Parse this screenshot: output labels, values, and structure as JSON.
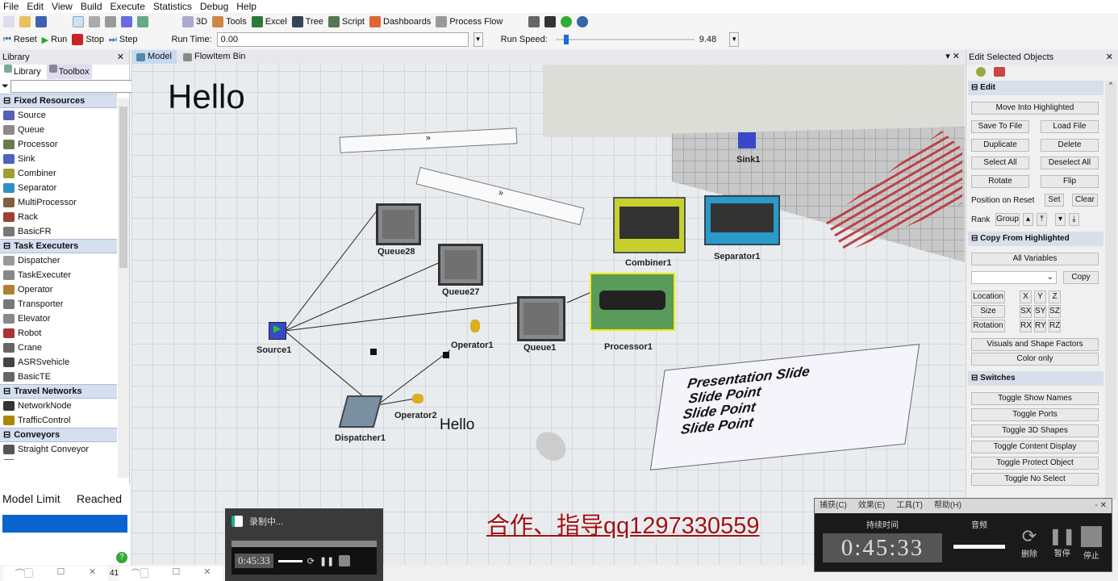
{
  "menu": [
    "File",
    "Edit",
    "View",
    "Build",
    "Execute",
    "Statistics",
    "Debug",
    "Help"
  ],
  "toolbar": {
    "3d": "3D",
    "tools": "Tools",
    "excel": "Excel",
    "tree": "Tree",
    "script": "Script",
    "dashboards": "Dashboards",
    "process_flow": "Process Flow"
  },
  "run": {
    "reset": "Reset",
    "run": "Run",
    "stop": "Stop",
    "step": "Step",
    "run_time_label": "Run Time:",
    "run_time": "0.00",
    "run_speed_label": "Run Speed:",
    "run_speed": "9.48"
  },
  "library": {
    "title": "Library",
    "tab_library": "Library",
    "tab_toolbox": "Toolbox",
    "search_placeholder": "",
    "sections": [
      {
        "title": "Fixed Resources",
        "items": [
          "Source",
          "Queue",
          "Processor",
          "Sink",
          "Combiner",
          "Separator",
          "MultiProcessor",
          "Rack",
          "BasicFR"
        ]
      },
      {
        "title": "Task Executers",
        "items": [
          "Dispatcher",
          "TaskExecuter",
          "Operator",
          "Transporter",
          "Elevator",
          "Robot",
          "Crane",
          "ASRSvehicle",
          "BasicTE"
        ]
      },
      {
        "title": "Travel Networks",
        "items": [
          "NetworkNode",
          "TrafficControl"
        ]
      },
      {
        "title": "Conveyors",
        "items": [
          "Straight Conveyor",
          "Curved Conveyor"
        ]
      }
    ]
  },
  "model_limit": {
    "left": "Model Limit",
    "right": "Reached"
  },
  "tabs": {
    "model": "Model",
    "flowitem_bin": "FlowItem Bin"
  },
  "canvas": {
    "hello_big": "Hello",
    "hello_small": "Hello",
    "objects": {
      "queue28": "Queue28",
      "queue27": "Queue27",
      "queue1": "Queue1",
      "source1": "Source1",
      "operator1": "Operator1",
      "operator2": "Operator2",
      "dispatcher1": "Dispatcher1",
      "processor1": "Processor1",
      "combiner1": "Combiner1",
      "separator1": "Separator1",
      "sink1": "Sink1"
    },
    "slide": {
      "title": "Presentation Slide",
      "points": [
        "Slide Point",
        "Slide Point",
        "Slide Point"
      ]
    },
    "watermark": "合作、指导qq1297330559"
  },
  "edit_panel": {
    "title": "Edit Selected Objects",
    "edit": "Edit",
    "move_into": "Move Into Highlighted",
    "save_to_file": "Save To File",
    "load_file": "Load File",
    "duplicate": "Duplicate",
    "delete": "Delete",
    "select_all": "Select All",
    "deselect_all": "Deselect All",
    "rotate": "Rotate",
    "flip": "Flip",
    "position_on_reset": "Position on Reset",
    "set": "Set",
    "clear": "Clear",
    "rank": "Rank",
    "group": "Group",
    "copy_from": "Copy From Highlighted",
    "all_variables": "All Variables",
    "copy": "Copy",
    "location": "Location",
    "size": "Size",
    "rotation": "Rotation",
    "x": "X",
    "y": "Y",
    "z": "Z",
    "sx": "SX",
    "sy": "SY",
    "sz": "SZ",
    "rx": "RX",
    "ry": "RY",
    "rz": "RZ",
    "visuals": "Visuals and Shape Factors",
    "color_only": "Color only",
    "switches": "Switches",
    "switch_items": [
      "Toggle Show Names",
      "Toggle Ports",
      "Toggle 3D Shapes",
      "Toggle Content Display",
      "Toggle Protect Object",
      "Toggle No Select"
    ]
  },
  "recorder_small": {
    "title": "录制中...",
    "time": "0:45:33"
  },
  "recorder": {
    "menu": [
      "捕获(C)",
      "效果(E)",
      "工具(T)",
      "帮助(H)"
    ],
    "duration_label": "持续时间",
    "time": "0:45:33",
    "audio_label": "音频",
    "delete": "删除",
    "pause": "暂停",
    "stop": "停止"
  },
  "taskbar": {
    "left_num": "41"
  }
}
